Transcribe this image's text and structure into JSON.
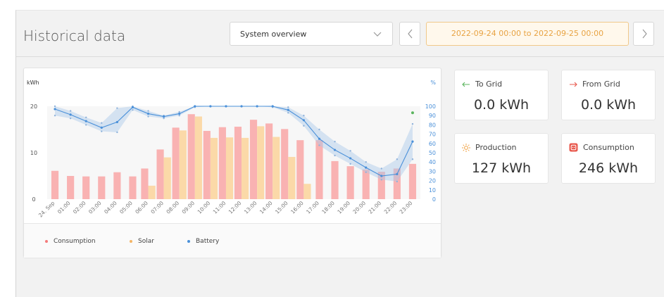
{
  "header": {
    "title": "Historical data",
    "view_select": "System overview",
    "date_range": "2022-09-24 00:00 to 2022-09-25 00:00"
  },
  "stats": [
    {
      "label": "To Grid",
      "value": "0.0 kWh",
      "icon": "arrow-left-icon",
      "color": "#5bb55e"
    },
    {
      "label": "From Grid",
      "value": "0.0 kWh",
      "icon": "arrow-right-icon",
      "color": "#e85a4f"
    },
    {
      "label": "Production",
      "value": "127 kWh",
      "icon": "sun-icon",
      "color": "#f0a040"
    },
    {
      "label": "Consumption",
      "value": "246 kWh",
      "icon": "plug-icon",
      "color": "#e85a4f"
    }
  ],
  "chart_data": {
    "type": "bar",
    "left_unit": "kWh",
    "right_unit": "%",
    "ylim": [
      0,
      20
    ],
    "yticks": [
      0,
      10,
      20
    ],
    "y2lim": [
      0,
      100
    ],
    "y2ticks": [
      0,
      10,
      20,
      30,
      40,
      50,
      60,
      70,
      80,
      90,
      100
    ],
    "categories": [
      "24. Sep",
      "01:00",
      "02:00",
      "03:00",
      "04:00",
      "05:00",
      "06:00",
      "07:00",
      "08:00",
      "09:00",
      "10:00",
      "11:00",
      "12:00",
      "13:00",
      "14:00",
      "15:00",
      "16:00",
      "17:00",
      "18:00",
      "19:00",
      "20:00",
      "21:00",
      "22:00",
      "23:00"
    ],
    "series": [
      {
        "name": "Consumption",
        "color": "#f9b2b2",
        "legend_color": "#f47a7a",
        "values": [
          6.1,
          5.0,
          4.9,
          4.9,
          5.8,
          4.9,
          6.6,
          10.7,
          15.4,
          18.3,
          14.7,
          15.5,
          15.6,
          17.1,
          16.3,
          15.1,
          12.7,
          12.7,
          8.2,
          7.1,
          6.4,
          5.9,
          6.6,
          7.6
        ]
      },
      {
        "name": "Solar",
        "color": "#fbd9a8",
        "legend_color": "#f4b565",
        "values": [
          0,
          0,
          0,
          0,
          0,
          0,
          2.9,
          9.0,
          14.8,
          17.8,
          13.2,
          13.3,
          13.2,
          15.7,
          13.4,
          9.1,
          3.3,
          0,
          0,
          0,
          0,
          0,
          0,
          0
        ]
      },
      {
        "name": "Battery",
        "color": "#4a90d9",
        "legend_color": "#4a90d9",
        "axis": "right",
        "values": [
          97,
          91,
          84,
          77,
          83,
          99,
          92,
          89,
          92,
          100,
          100,
          100,
          100,
          100,
          100,
          96,
          85,
          65,
          53,
          44,
          34,
          25,
          27,
          62
        ],
        "band_high": [
          100,
          95,
          88,
          82,
          98,
          100,
          95,
          90,
          94,
          100,
          100,
          100,
          100,
          100,
          100,
          99,
          90,
          75,
          62,
          52,
          40,
          33,
          43,
          81
        ],
        "band_low": [
          90,
          87,
          80,
          73,
          72,
          96,
          89,
          87,
          90,
          99,
          100,
          100,
          100,
          100,
          99,
          93,
          79,
          58,
          47,
          38,
          29,
          21,
          19,
          43
        ]
      }
    ],
    "extra_point": {
      "index": 23,
      "value": 93,
      "color": "#5bb55e"
    }
  },
  "legend": [
    "Consumption",
    "Solar",
    "Battery"
  ]
}
